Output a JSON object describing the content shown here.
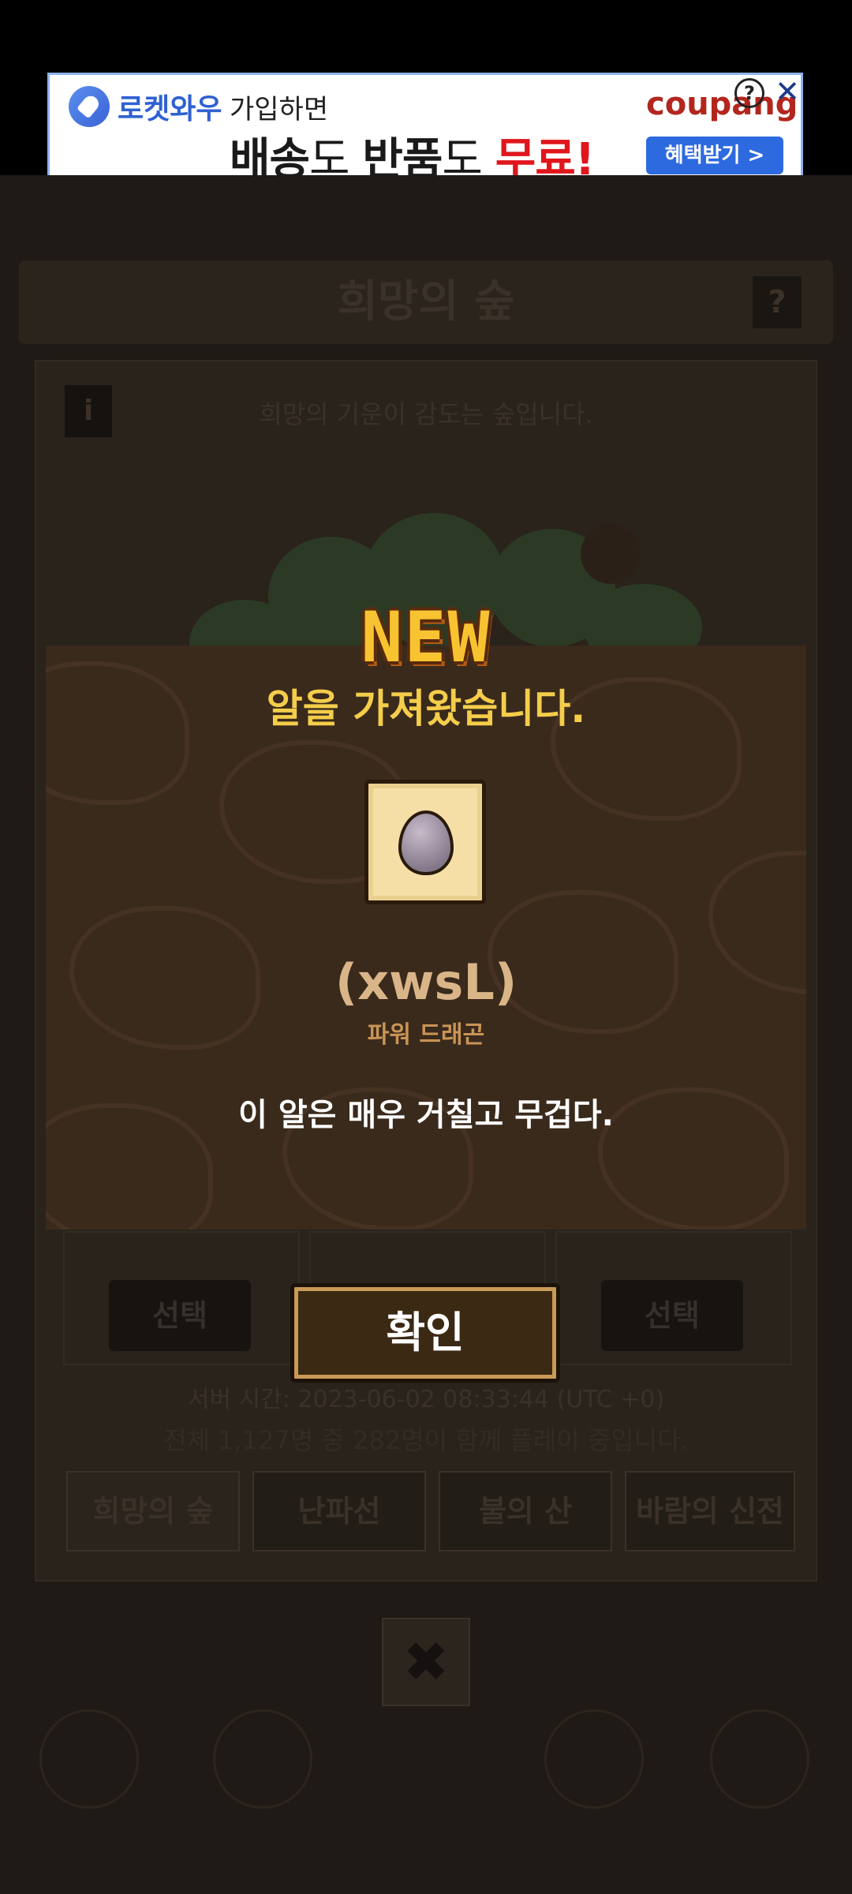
{
  "ad": {
    "brand": "로켓와우",
    "line1": "가입하면",
    "line2_a": "배송",
    "line2_b": "도 ",
    "line2_c": "반품",
    "line2_d": "도 ",
    "line2_e": "무료!",
    "coupang": "coupang",
    "cta": "혜택받기 >",
    "info_icon": "?",
    "close_icon": "✕"
  },
  "background": {
    "title": "희망의 숲",
    "help": "?",
    "info": "i",
    "description": "희망의 기운이 감도는 숲입니다.",
    "select_label": "선택",
    "server_time": "서버 시간: 2023-06-02 08:33:44 (UTC +0)",
    "users": "전체 1,127명 중 282명이 함께 플레이 중입니다.",
    "tabs": [
      "희망의 숲",
      "난파선",
      "불의 산",
      "바람의 신전"
    ],
    "close": "✖"
  },
  "popup": {
    "badge": "NEW",
    "title": "알을 가져왔습니다.",
    "egg_name": "(xwsL)",
    "egg_type": "파워 드래곤",
    "egg_desc": "이 알은 매우 거칠고 무겁다.",
    "confirm": "확인"
  }
}
